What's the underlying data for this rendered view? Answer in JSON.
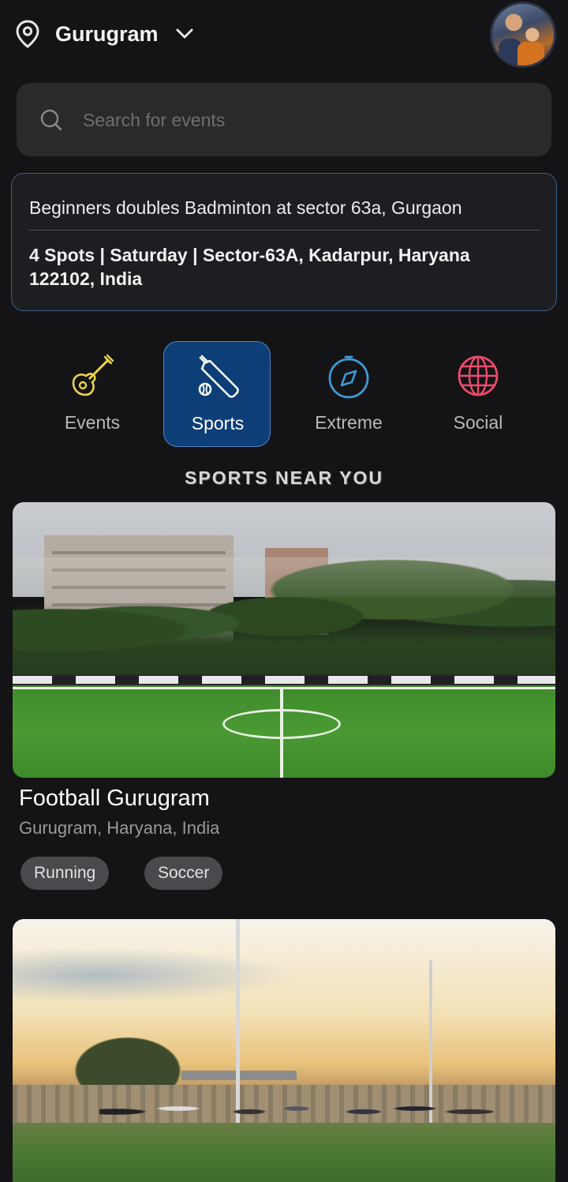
{
  "header": {
    "location": "Gurugram",
    "icons": {
      "location": "map-pin-icon",
      "dropdown": "chevron-down-icon"
    }
  },
  "search": {
    "placeholder": "Search for events",
    "icon": "search-icon"
  },
  "featured_event": {
    "title": "Beginners doubles Badminton at sector 63a, Gurgaon",
    "details": "4 Spots | Saturday | Sector-63A, Kadarpur, Haryana 122102, India"
  },
  "categories": [
    {
      "label": "Events",
      "icon": "guitar-icon",
      "color": "#e8d44a",
      "active": false
    },
    {
      "label": "Sports",
      "icon": "cricket-bat-icon",
      "color": "#ffffff",
      "active": true
    },
    {
      "label": "Extreme",
      "icon": "compass-icon",
      "color": "#3e9ad6",
      "active": false
    },
    {
      "label": "Social",
      "icon": "globe-icon",
      "color": "#ec4a6a",
      "active": false
    }
  ],
  "section_title": "SPORTS NEAR YOU",
  "venues": [
    {
      "name": "Football Gurugram",
      "location": "Gurugram, Haryana, India",
      "tags": [
        "Running",
        "Soccer"
      ]
    },
    {}
  ],
  "colors": {
    "background": "#141416",
    "active_tab": "#0e3e77",
    "banner_border": "#3a5f86"
  }
}
